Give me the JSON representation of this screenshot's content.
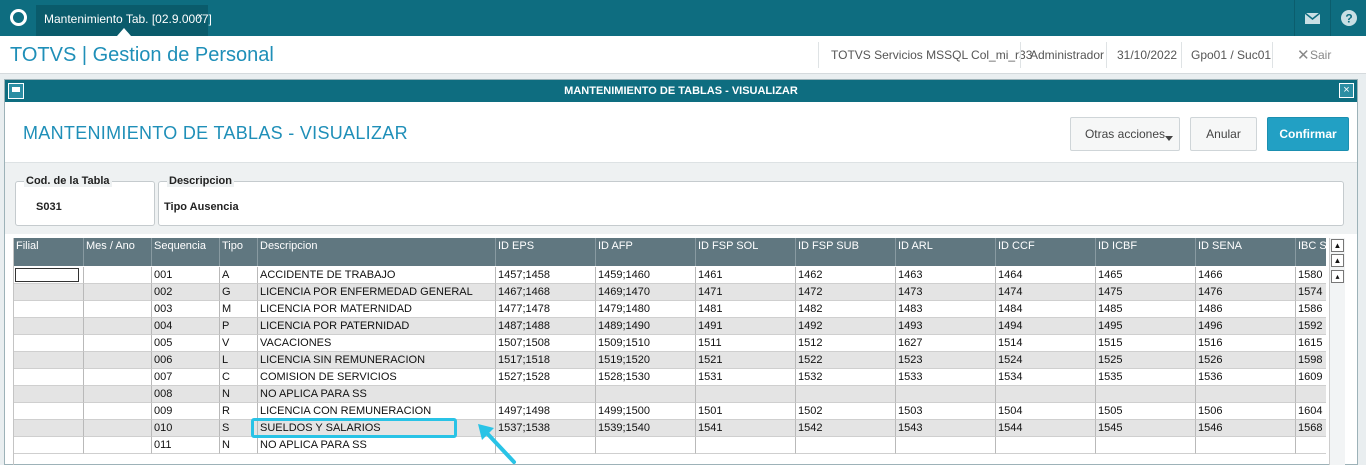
{
  "topbar": {
    "tab_label": "Mantenimiento Tab. [02.9.0007]",
    "tab_close": "×"
  },
  "header": {
    "app_title": "TOTVS | Gestion de Personal",
    "server": "TOTVS Servicios MSSQL Col_mi_r33",
    "user": "Administrador",
    "date": "31/10/2022",
    "branch": "Gpo01 / Suc01",
    "exit_label": "Sair"
  },
  "window": {
    "title": "MANTENIMIENTO DE TABLAS - VISUALIZAR",
    "page_title": "MANTENIMIENTO DE TABLAS - VISUALIZAR",
    "buttons": {
      "otras": "Otras acciones",
      "anular": "Anular",
      "confirmar": "Confirmar"
    },
    "fields": {
      "cod_label": "Cod. de la Tabla",
      "cod_value": "S031",
      "desc_label": "Descripcion",
      "desc_value": "Tipo Ausencia"
    }
  },
  "grid": {
    "columns": [
      "Filial",
      "Mes / Ano",
      "Sequencia",
      "Tipo",
      "Descripcion",
      "ID EPS",
      "ID AFP",
      "ID FSP SOL",
      "ID FSP SUB",
      "ID ARL",
      "ID CCF",
      "ID ICBF",
      "ID SENA",
      "IBC SEN"
    ],
    "rows": [
      [
        "",
        "",
        "001",
        "A",
        "ACCIDENTE DE TRABAJO",
        "1457;1458",
        "1459;1460",
        "1461",
        "1462",
        "1463",
        "1464",
        "1465",
        "1466",
        "1580"
      ],
      [
        "",
        "",
        "002",
        "G",
        "LICENCIA POR ENFERMEDAD GENERAL",
        "1467;1468",
        "1469;1470",
        "1471",
        "1472",
        "1473",
        "1474",
        "1475",
        "1476",
        "1574"
      ],
      [
        "",
        "",
        "003",
        "M",
        "LICENCIA POR MATERNIDAD",
        "1477;1478",
        "1479;1480",
        "1481",
        "1482",
        "1483",
        "1484",
        "1485",
        "1486",
        "1586"
      ],
      [
        "",
        "",
        "004",
        "P",
        "LICENCIA POR PATERNIDAD",
        "1487;1488",
        "1489;1490",
        "1491",
        "1492",
        "1493",
        "1494",
        "1495",
        "1496",
        "1592"
      ],
      [
        "",
        "",
        "005",
        "V",
        "VACACIONES",
        "1507;1508",
        "1509;1510",
        "1511",
        "1512",
        "1627",
        "1514",
        "1515",
        "1516",
        "1615"
      ],
      [
        "",
        "",
        "006",
        "L",
        "LICENCIA SIN REMUNERACION",
        "1517;1518",
        "1519;1520",
        "1521",
        "1522",
        "1523",
        "1524",
        "1525",
        "1526",
        "1598"
      ],
      [
        "",
        "",
        "007",
        "C",
        "COMISION DE SERVICIOS",
        "1527;1528",
        "1528;1530",
        "1531",
        "1532",
        "1533",
        "1534",
        "1535",
        "1536",
        "1609"
      ],
      [
        "",
        "",
        "008",
        "N",
        "NO APLICA PARA SS",
        "",
        "",
        "",
        "",
        "",
        "",
        "",
        "",
        ""
      ],
      [
        "",
        "",
        "009",
        "R",
        "LICENCIA CON REMUNERACION",
        "1497;1498",
        "1499;1500",
        "1501",
        "1502",
        "1503",
        "1504",
        "1505",
        "1506",
        "1604"
      ],
      [
        "",
        "",
        "010",
        "S",
        "SUELDOS Y SALARIOS",
        "1537;1538",
        "1539;1540",
        "1541",
        "1542",
        "1543",
        "1544",
        "1545",
        "1546",
        "1568"
      ],
      [
        "",
        "",
        "011",
        "N",
        "NO APLICA PARA SS",
        "",
        "",
        "",
        "",
        "",
        "",
        "",
        "",
        ""
      ]
    ]
  },
  "annotation": {
    "highlight_color": "#29c3e6",
    "highlighted_row": "010"
  }
}
